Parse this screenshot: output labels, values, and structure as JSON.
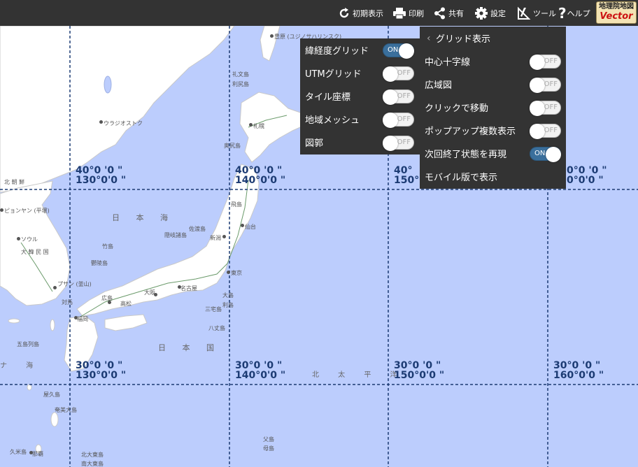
{
  "toolbar": {
    "reset_label": "初期表示",
    "print_label": "印刷",
    "share_label": "共有",
    "settings_label": "設定",
    "tools_label": "ツール",
    "help_label": "ヘルプ",
    "logo_line1": "地理院地図",
    "logo_line2": "Vector"
  },
  "grid_panel": {
    "items": [
      {
        "label": "緯経度グリッド",
        "state": "ON"
      },
      {
        "label": "UTMグリッド",
        "state": "OFF"
      },
      {
        "label": "タイル座標",
        "state": "OFF"
      },
      {
        "label": "地域メッシュ",
        "state": "OFF"
      },
      {
        "label": "図郭",
        "state": "OFF"
      }
    ]
  },
  "settings_panel": {
    "back_icon": "‹",
    "title": "グリッド表示",
    "items": [
      {
        "label": "中心十字線",
        "state": "OFF"
      },
      {
        "label": "広域図",
        "state": "OFF"
      },
      {
        "label": "クリックで移動",
        "state": "OFF"
      },
      {
        "label": "ポップアップ複数表示",
        "state": "OFF"
      },
      {
        "label": "次回終了状態を再現",
        "state": "ON"
      },
      {
        "label": "モバイル版で表示",
        "state": ""
      }
    ]
  },
  "grid_labels": {
    "r40_130": {
      "lat": "40°0 '0 \"",
      "lon": "130°0'0 \""
    },
    "r40_140": {
      "lat": "40°0 '0 \"",
      "lon": "140°0'0 \""
    },
    "r40_150": {
      "lat": "40°",
      "lon": "150°"
    },
    "r40_160": {
      "lat": "0°0 '0 \"",
      "lon": "0°0'0 \""
    },
    "r30_130": {
      "lat": "30°0 '0 \"",
      "lon": "130°0'0 \""
    },
    "r30_140": {
      "lat": "30°0 '0 \"",
      "lon": "140°0'0 \""
    },
    "r30_150": {
      "lat": "30°0 '0 \"",
      "lon": "150°0'0 \""
    },
    "r30_160": {
      "lat": "30°0 '0 \"",
      "lon": "160°0'0 \""
    }
  },
  "map_labels": {
    "sea_of_japan": "日 本 海",
    "japan": "日 本 国",
    "pacific": "北 太 平 洋",
    "north_korea": "北 朝 鮮",
    "pyongyang": "ピョンヤン (平壌)",
    "seoul": "ソウル",
    "south_korea": "大 韓 民 国",
    "busan": "プサン (釜山)",
    "vladivostok": "ウラジオストク",
    "sapporo": "札幌",
    "toyohara": "豊原 (ユジノサハリンスク)",
    "osaka": "大阪",
    "nagoya": "名古屋",
    "tokyo": "東京",
    "sendai": "仙台",
    "fukuoka": "福岡",
    "hiroshima": "広島",
    "takamatsu": "高松",
    "niigata": "新潟",
    "naha": "那覇",
    "east_china_sea": "ナ 海",
    "sado": "佐渡島",
    "oki": "隠岐諸島",
    "takeshima": "竹島",
    "okushiri": "奥尻島",
    "tobishima": "飛島",
    "rishiri": "利尻島",
    "rebun": "礼文島",
    "izu": "八丈島",
    "miyake": "三宅島",
    "tsushima": "対馬",
    "gotoh": "五島列島",
    "yakushima": "屋久島",
    "amami": "奄美大島",
    "kume": "久米島",
    "ulleungdo": "鬱陵島",
    "ogasawara": "父島",
    "hahajima": "母島",
    "kitadaito": "北大東島",
    "minamidaito": "南大東島",
    "oshima": "大島",
    "toshima": "利島",
    "hachijo_label": "八丈島"
  }
}
